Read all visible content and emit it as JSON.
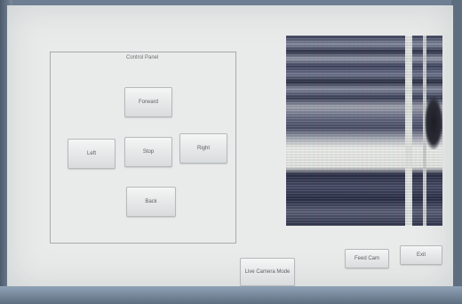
{
  "control_panel": {
    "title": "Control Panel",
    "buttons": {
      "forward": "Forward",
      "left": "Left",
      "stop": "Stop",
      "right": "Right",
      "back": "Back"
    }
  },
  "bottom_buttons": {
    "center": "Live Camera Mode",
    "snapshot": "Feed Cam",
    "exit": "Exit"
  },
  "icons": {
    "camera_view": "camera-feed-image"
  }
}
